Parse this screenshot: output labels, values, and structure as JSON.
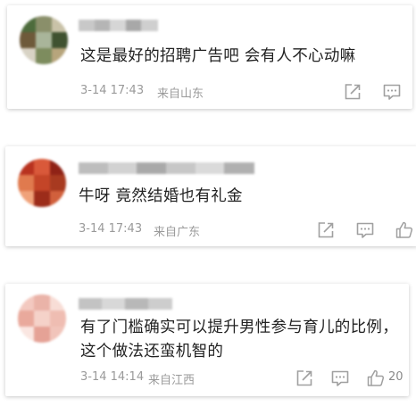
{
  "comments": [
    {
      "text_lines": [
        "这是最好的招聘广告吧 会有人不心动嘛"
      ],
      "time": "3-14 17:43",
      "location": "来自山东",
      "like_count": "",
      "avatar_colors": [
        "#4d6b3c",
        "#8a8f6a",
        "#c9c2a8",
        "#6e5a3a",
        "#a9b59a",
        "#3f5230",
        "#d8d3c5",
        "#7d8c5e",
        "#b7a57c"
      ],
      "name_colors": [
        "#c8c8c8",
        "#b5b5b5",
        "#d6d6d6",
        "#a8a8a8",
        "#cfcfcf"
      ]
    },
    {
      "text_lines": [
        "牛呀 竟然结婚也有礼金"
      ],
      "time": "3-14 17:43",
      "location": "来自广东",
      "like_count": "",
      "avatar_colors": [
        "#b8321f",
        "#d9593a",
        "#8f2216",
        "#e07a4e",
        "#c44528",
        "#a83a20",
        "#f0a27a",
        "#9c2c1a",
        "#d1603c"
      ],
      "name_colors": [
        "#bdbdbd",
        "#d2d2d2",
        "#a9a9a9",
        "#c7c7c7",
        "#dadada",
        "#b0b0b0"
      ]
    },
    {
      "text_lines": [
        "有了门槛确实可以提升男性参与育儿的比例，",
        "这个做法还蛮机智的"
      ],
      "time": "3-14 14:14",
      "location": "来自江西",
      "like_count": "20",
      "avatar_colors": [
        "#f3c9c0",
        "#eab3a8",
        "#f8ddd6",
        "#e9a99c",
        "#f5d2c9",
        "#efbdb2",
        "#fae6e1",
        "#e5a296",
        "#f1c4ba"
      ],
      "name_colors": [
        "#c3c3c3",
        "#d8d8d8",
        "#b8b8b8",
        "#cdcdcd"
      ]
    }
  ],
  "icons": {
    "share": "share-icon",
    "comment": "comment-icon",
    "like": "like-icon"
  },
  "colors": {
    "text": "#222222",
    "meta": "#9a9a9a",
    "icon": "#a0a0a0"
  }
}
